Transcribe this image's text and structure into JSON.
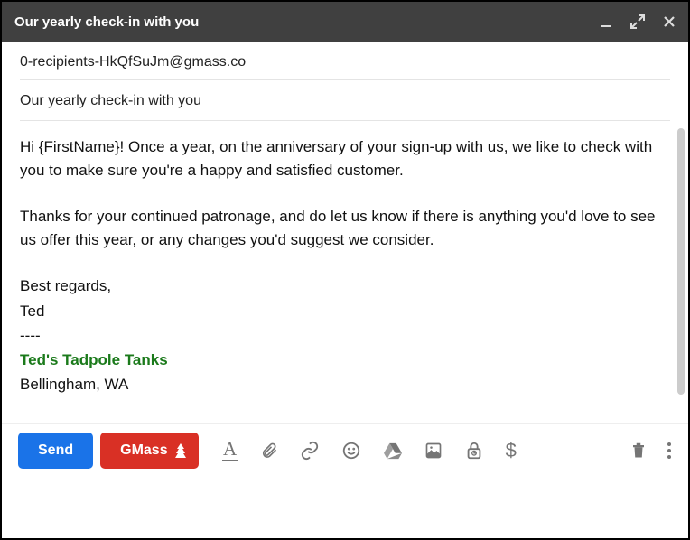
{
  "window": {
    "title": "Our yearly check-in with you"
  },
  "fields": {
    "to": "0-recipients-HkQfSuJm@gmass.co",
    "subject": "Our yearly check-in with you"
  },
  "body": {
    "para1": "Hi {FirstName}! Once a year, on the anniversary of your sign-up with us, we like to check with you to make sure you're a happy and satisfied customer.",
    "para2": "Thanks for your continued patronage, and do let us know if there is anything you'd love to see us offer this year, or any changes you'd suggest we consider.",
    "closing": "Best regards,",
    "name": "Ted",
    "divider": "----",
    "company": "Ted's Tadpole Tanks",
    "location": "Bellingham, WA"
  },
  "toolbar": {
    "send_label": "Send",
    "gmass_label": "GMass",
    "format_glyph": "A",
    "money_glyph": "$"
  }
}
